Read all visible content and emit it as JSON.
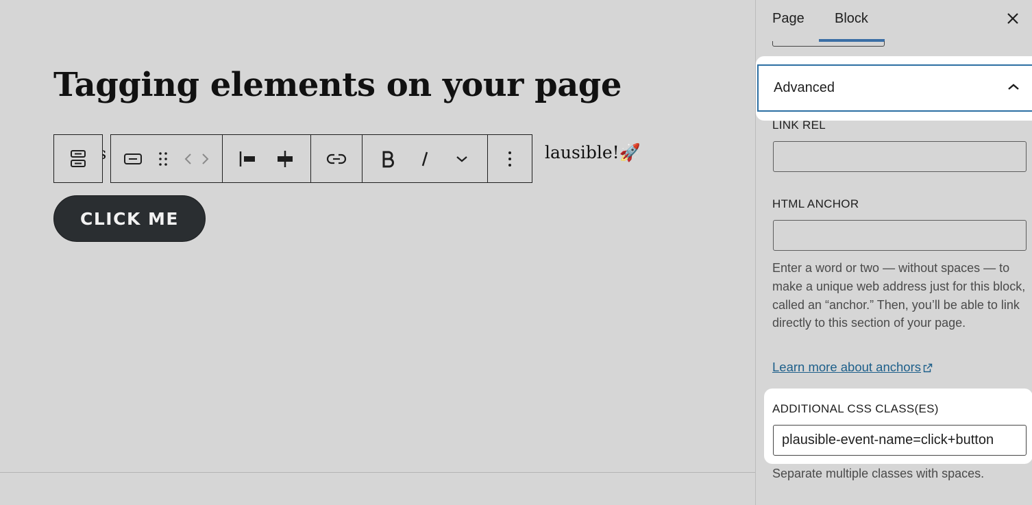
{
  "editor": {
    "heading": "Tagging elements on your page",
    "paragraph_left_fragment": "s",
    "paragraph_right_fragment": "lausible!🚀",
    "button_label": "CLICK ME"
  },
  "toolbar": {
    "icons": [
      "button-block-icon",
      "button-style-icon",
      "drag-handle-icon",
      "move-arrows-icon",
      "align-left-icon",
      "justify-center-icon",
      "link-icon",
      "bold-icon",
      "italic-icon",
      "more-chevron-icon",
      "options-dots-icon"
    ]
  },
  "sidebar": {
    "tabs": [
      {
        "label": "Page",
        "active": false
      },
      {
        "label": "Block",
        "active": true
      }
    ],
    "advanced": {
      "title": "Advanced",
      "link_rel_label": "LINK REL",
      "link_rel_value": "",
      "html_anchor_label": "HTML ANCHOR",
      "html_anchor_value": "",
      "anchor_help": "Enter a word or two — without spaces — to make a unique web address just for this block, called an “anchor.” Then, you’ll be able to link directly to this section of your page.",
      "anchor_link": "Learn more about anchors",
      "css_label": "ADDITIONAL CSS CLASS(ES)",
      "css_value": "plausible-event-name=click+button",
      "css_help": "Separate multiple classes with spaces."
    }
  },
  "colors": {
    "accent": "#2b6ea2",
    "link": "#1d5f8a",
    "button_bg": "#2a2e31",
    "highlight": "#ffffff"
  }
}
